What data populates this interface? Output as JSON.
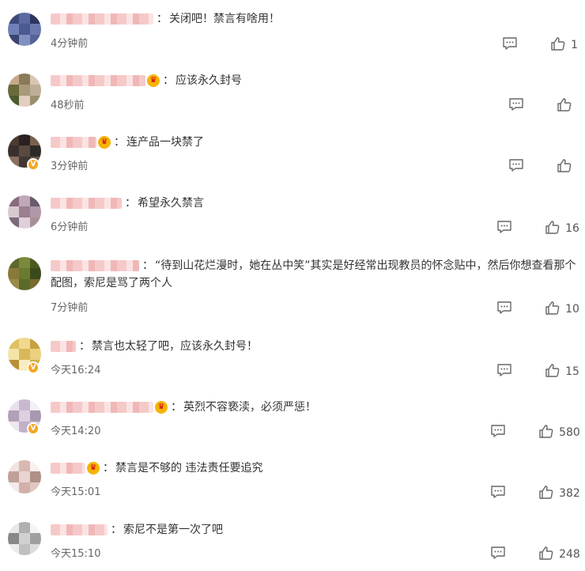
{
  "comments": [
    {
      "text": "关闭吧！禁言有啥用！",
      "time": "4分钟前",
      "likes": "1",
      "avatar": [
        "#3c4a7a",
        "#5a6aa0",
        "#2d3560",
        "#7080b8",
        "#4b5a90",
        "#6a78ad",
        "#3a466f",
        "#8090c0",
        "#556399"
      ]
    },
    {
      "text": "应该永久封号",
      "time": "48秒前",
      "likes": "",
      "avatar": [
        "#c7a98a",
        "#8a7a5a",
        "#d9c6b2",
        "#6a6a3a",
        "#a89a7a",
        "#bfae96",
        "#4d5a2e",
        "#e0cfc0",
        "#9a8e6e"
      ]
    },
    {
      "text": "连产品一块禁了",
      "time": "3分钟前",
      "likes": "",
      "avatar": [
        "#4a3a30",
        "#2a2220",
        "#7a6050",
        "#3a3030",
        "#5a4a40",
        "#2e2a28",
        "#8a7060",
        "#403634",
        "#6a5448"
      ]
    },
    {
      "text": "希望永久禁言",
      "time": "6分钟前",
      "likes": "16",
      "avatar": [
        "#8a6a80",
        "#c0a8b8",
        "#6a5a70",
        "#d8c8d0",
        "#9a8090",
        "#b098a8",
        "#7a6a7a",
        "#e0d0d8",
        "#a89098"
      ]
    },
    {
      "text": "“待到山花烂漫时，她在丛中笑”其实是好经常出现教员的怀念贴中，然后你想查看那个配图，索尼是骂了两个人",
      "time": "7分钟前",
      "likes": "10",
      "avatar": [
        "#5a6a2a",
        "#7a8a3a",
        "#4a5a20",
        "#8a7a3a",
        "#6a7a30",
        "#3a4a1a",
        "#9a8a4a",
        "#5a6a28",
        "#7a6a30"
      ]
    },
    {
      "text": "禁言也太轻了吧，应该永久封号！",
      "time": "今天16:24",
      "likes": "15",
      "avatar": [
        "#e0c060",
        "#f0d890",
        "#c8a040",
        "#f4e4a8",
        "#d8b858",
        "#ecd080",
        "#b89038",
        "#f8ecc0",
        "#d0b050"
      ]
    },
    {
      "text": "英烈不容亵渎，必须严惩！",
      "time": "今天14:20",
      "likes": "580",
      "avatar": [
        "#e8e0ec",
        "#c8b8d0",
        "#f4eef6",
        "#b0a0b8",
        "#dcd0e0",
        "#a898b0",
        "#eee6f0",
        "#c0b0c8",
        "#d8cce0"
      ]
    },
    {
      "text": "禁言是不够的 违法责任要追究",
      "time": "今天15:01",
      "likes": "382",
      "avatar": [
        "#f0e4e0",
        "#d8b8b0",
        "#f8f0ee",
        "#c0a098",
        "#e8d4d0",
        "#b09088",
        "#f4ebe8",
        "#d0b0a8",
        "#e0c8c0"
      ]
    },
    {
      "text": "索尼不是第一次了吧",
      "time": "今天15:10",
      "likes": "248",
      "avatar": [
        "#e8e8e8",
        "#b0b0b0",
        "#f4f4f4",
        "#888888",
        "#d0d0d0",
        "#a0a0a0",
        "#ececec",
        "#c0c0c0",
        "#dcdcdc"
      ]
    }
  ],
  "colors": {
    "meta": "#666666",
    "icon": "#666666"
  },
  "icons": {
    "reply": "comment-icon",
    "like": "thumbs-up-icon",
    "verified": "v-badge-icon",
    "vip": "crown-badge-icon"
  }
}
